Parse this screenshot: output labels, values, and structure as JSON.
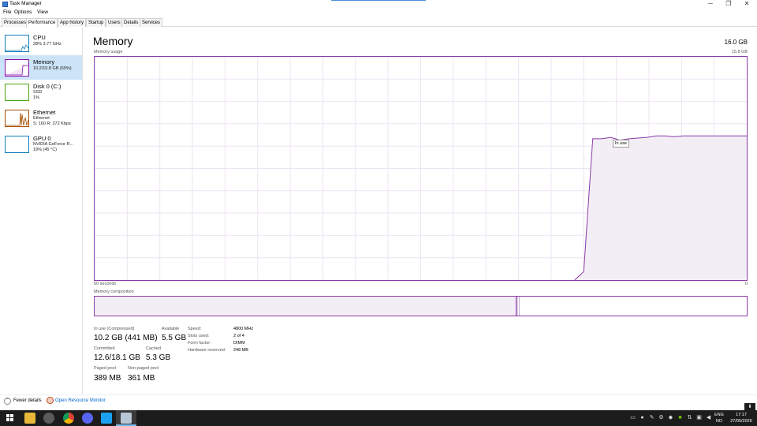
{
  "window": {
    "title": "Task Manager",
    "min": "─",
    "restore": "❐",
    "close": "✕"
  },
  "menu": [
    "File",
    "Options",
    "View"
  ],
  "tabs": [
    "Processes",
    "Performance",
    "App history",
    "Startup",
    "Users",
    "Details",
    "Services"
  ],
  "sidebar": [
    {
      "title": "CPU",
      "sub1": "28% 3.77 GHz",
      "sub2": "",
      "color": "#117dbb"
    },
    {
      "title": "Memory",
      "sub1": "10.2/15.8 GB (65%)",
      "sub2": "",
      "color": "#8b12ae"
    },
    {
      "title": "Disk 0 (C:)",
      "sub1": "SSD",
      "sub2": "1%",
      "color": "#4da60c"
    },
    {
      "title": "Ethernet",
      "sub1": "Ethernet",
      "sub2": "S: 160 R: 272 Kbps",
      "color": "#a74f01"
    },
    {
      "title": "GPU 0",
      "sub1": "NVIDIA GeForce R...",
      "sub2": "19% (45 °C)",
      "color": "#117dbb"
    }
  ],
  "memory": {
    "title": "Memory",
    "total": "16.0 GB",
    "usage_label": "Memory usage",
    "usage_max": "15.8 GB",
    "tooltip": "In use",
    "axis_left": "60 seconds",
    "axis_right": "0",
    "composition_label": "Memory composition",
    "composition_in_use_fraction": 0.647,
    "composition_modified_fraction": 0.003,
    "composition_standby_fraction": 0.335,
    "usage_history": [
      0,
      0,
      0,
      0,
      0,
      0,
      0,
      0,
      0,
      0,
      0,
      0,
      0,
      0,
      0,
      0,
      0,
      0,
      0,
      0,
      0,
      0,
      0,
      0,
      0,
      0,
      0,
      0,
      0,
      0,
      0,
      0,
      0,
      0,
      0,
      0,
      0,
      0,
      0,
      0,
      0,
      0,
      0,
      0,
      0,
      0,
      0,
      0,
      0,
      0,
      0,
      0,
      0,
      0,
      0.6,
      10.0,
      10.0,
      10.1,
      9.9,
      10.0,
      10.05,
      10.1,
      10.2,
      10.2,
      10.15,
      10.2,
      10.2,
      10.2,
      10.2,
      10.2,
      10.2,
      10.2,
      10.2
    ]
  },
  "stats": {
    "in_use_label": "In use (Compressed)",
    "in_use": "10.2 GB (441 MB)",
    "available_label": "Available",
    "available": "5.5 GB",
    "committed_label": "Committed",
    "committed": "12.6/18.1 GB",
    "cached_label": "Cached",
    "cached": "5.3 GB",
    "paged_label": "Paged pool",
    "paged": "389 MB",
    "nonpaged_label": "Non-paged pool",
    "nonpaged": "361 MB"
  },
  "specs": [
    {
      "label": "Speed:",
      "value": "4800 MHz"
    },
    {
      "label": "Slots used:",
      "value": "2 of 4"
    },
    {
      "label": "Form factor:",
      "value": "DIMM"
    },
    {
      "label": "Hardware reserved:",
      "value": "248 MB"
    }
  ],
  "footer": {
    "fewer": "Fewer details",
    "resource_monitor": "Open Resource Monitor"
  },
  "taskbar": {
    "lang1": "ENG",
    "lang2": "NO",
    "time": "17:17",
    "date": "27/05/2026"
  }
}
